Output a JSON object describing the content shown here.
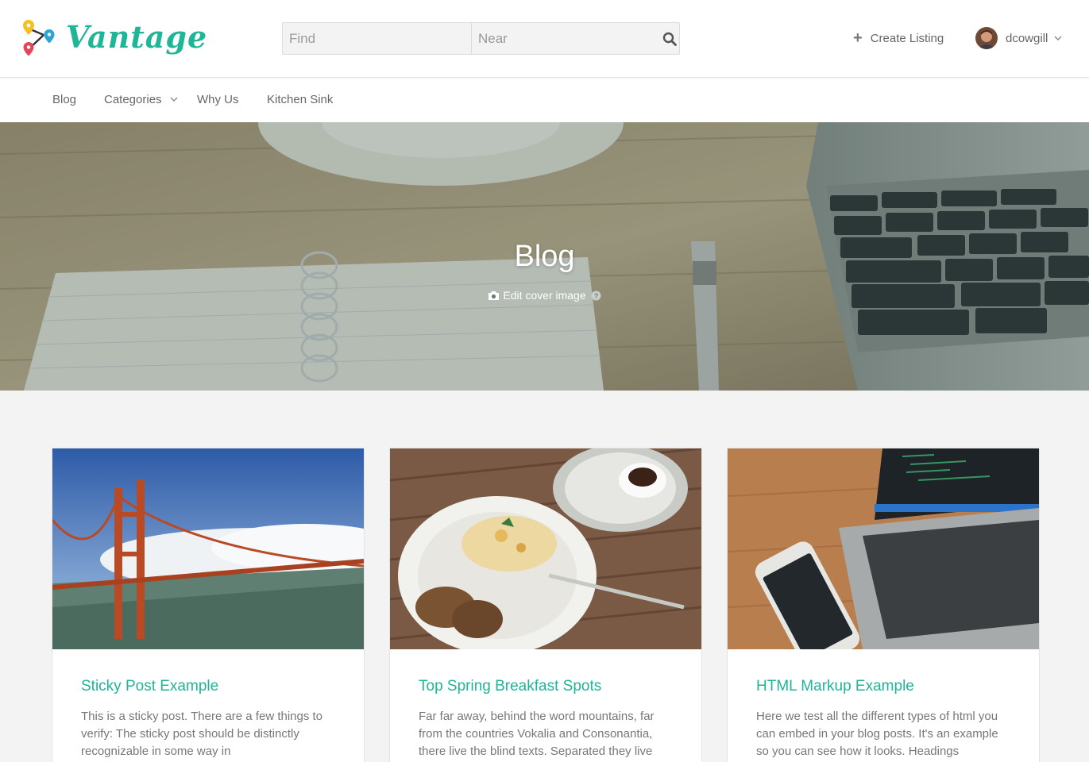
{
  "brand": {
    "name": "Vantage",
    "logo_text": "Vantage",
    "accent": "#1fb597"
  },
  "search": {
    "find_placeholder": "Find",
    "near_placeholder": "Near",
    "icon": "search-icon"
  },
  "header": {
    "create_label": "Create Listing",
    "create_icon": "plus-icon",
    "username": "dcowgill",
    "user_icon": "chevron-down-icon"
  },
  "nav": {
    "items": [
      {
        "label": "Blog"
      },
      {
        "label": "Categories",
        "has_dropdown": true
      },
      {
        "label": "Why Us"
      },
      {
        "label": "Kitchen Sink"
      }
    ]
  },
  "hero": {
    "title": "Blog",
    "edit_label": "Edit cover image",
    "edit_icon": "camera-icon",
    "help_icon": "question-circle-icon"
  },
  "posts": [
    {
      "title": "Sticky Post Example",
      "excerpt": "This is a sticky post. There are a few things to verify: The sticky post should be distinctly recognizable in some way in"
    },
    {
      "title": "Top Spring Breakfast Spots",
      "excerpt": "Far far away, behind the word mountains, far from the countries Vokalia and Consonantia, there live the blind texts. Separated they live"
    },
    {
      "title": "HTML Markup Example",
      "excerpt": "Here we test all the different types of html you can embed in your blog posts. It's an example so you can see how it looks. Headings"
    }
  ]
}
